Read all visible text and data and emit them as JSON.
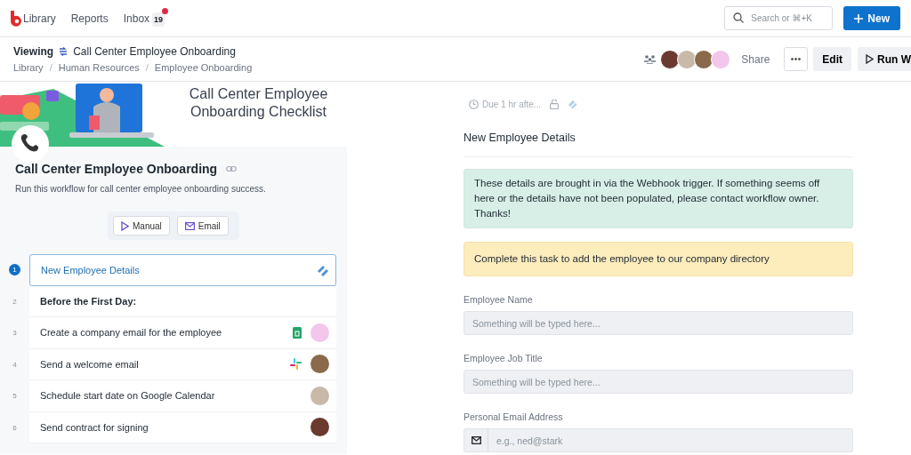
{
  "nav": {
    "links": [
      {
        "label": "Library",
        "selected": false
      },
      {
        "label": "Reports",
        "selected": false
      },
      {
        "label": "Inbox",
        "selected": false,
        "badge": "19",
        "unread": true
      }
    ],
    "search": {
      "placeholder": "Search or ⌘+K"
    },
    "new_button": "New"
  },
  "subheader": {
    "viewing": "Viewing",
    "title": "Call Center Employee Onboarding",
    "breadcrumbs": [
      "Library",
      "Human Resources",
      "Employee Onboarding"
    ],
    "breadcrumb_separator": "/",
    "avatars": [
      {
        "color": "#6b3a2e"
      },
      {
        "color": "#c9b9a8"
      },
      {
        "color": "#8a6a4a"
      },
      {
        "color": "#f3c6ec"
      }
    ],
    "share": "Share",
    "edit": "Edit",
    "run": "Run W"
  },
  "banner": {
    "kind": "picture",
    "title": "Call Center Employee Onboarding Checklist"
  },
  "workflow": {
    "title": "Call Center Employee Onboarding",
    "description": "Run this workflow for call center employee onboarding success.",
    "triggers": [
      {
        "kind": "manual",
        "label": "Manual"
      },
      {
        "kind": "email",
        "label": "Email"
      }
    ]
  },
  "steps": [
    {
      "number": "1",
      "label": "New Employee Details",
      "kind": "task",
      "selected": true,
      "app": {
        "kind": "webhook"
      }
    },
    {
      "number": "2",
      "label": "Before the First Day:",
      "kind": "heading",
      "selected": false
    },
    {
      "number": "3",
      "label": "Create a company email for the employee",
      "kind": "task",
      "selected": false,
      "app": {
        "kind": "sheets"
      },
      "color": "#f3c6ec"
    },
    {
      "number": "4",
      "label": "Send a welcome email",
      "kind": "task",
      "selected": false,
      "app": {
        "kind": "slack"
      },
      "color": "#8a6a4a"
    },
    {
      "number": "5",
      "label": "Schedule start date on Google Calendar",
      "kind": "task",
      "selected": false,
      "color": "#c9b9a8"
    },
    {
      "number": "6",
      "label": "Send contract for signing",
      "kind": "task",
      "selected": false,
      "color": "#6b3a2e"
    }
  ],
  "task": {
    "due": "Due 1 hr afte...",
    "title": "New Employee Details",
    "notes": [
      {
        "kind": "info",
        "text": "These details are brought in via the Webhook trigger. If something seems off here or the details have not been populated, please contact workflow owner. Thanks!"
      },
      {
        "kind": "warning",
        "text": "Complete this task to add the employee to our company directory"
      }
    ],
    "fields": [
      {
        "kind": "text",
        "label": "Employee Name",
        "placeholder": "Something will be typed here..."
      },
      {
        "kind": "text",
        "label": "Employee Job Title",
        "placeholder": "Something will be typed here..."
      },
      {
        "kind": "email",
        "label": "Personal Email Address",
        "placeholder": "e.g., ned@stark"
      }
    ]
  }
}
